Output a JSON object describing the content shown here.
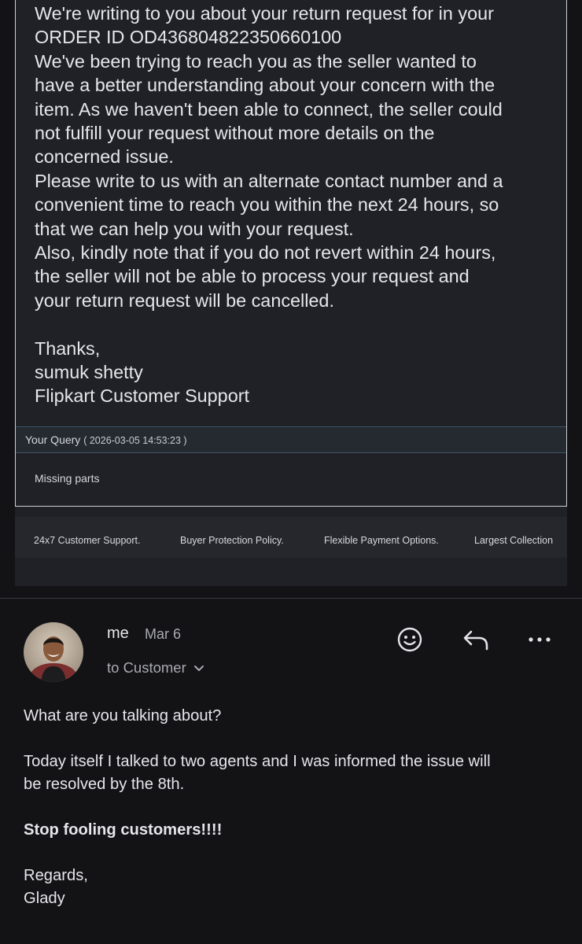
{
  "quoted_email": {
    "lines": [
      "We're writing to you about your return request for in your",
      "ORDER ID OD436804822350660100",
      "We've been trying to reach you as the seller wanted to",
      "have a better understanding about your concern with the",
      "item. As we haven't been able to connect, the seller could",
      "not fulfill your request without more details on the",
      "concerned issue.",
      "Please write to us with an alternate contact number and a",
      "convenient time to reach you within the next 24 hours, so",
      "that we can help you with your request.",
      "Also, kindly note that if you do not revert within 24 hours,",
      "the seller will not be able to process your request and",
      "your return request will be cancelled."
    ],
    "signoff": [
      "Thanks,",
      "sumuk shetty",
      "Flipkart Customer Support"
    ],
    "query_label": "Your Query",
    "query_timestamp": "( 2026-03-05 14:53:23 )",
    "query_text": "Missing parts",
    "features": [
      "24x7 Customer Support.",
      "Buyer Protection Policy.",
      "Flexible Payment Options.",
      "Largest Collection"
    ]
  },
  "reply": {
    "sender": "me",
    "date": "Mar 6",
    "recipient": "to Customer",
    "icons": [
      "avatar",
      "emoji-react-icon",
      "reply-icon",
      "more-options-icon",
      "chevron-down-icon"
    ],
    "body": {
      "p1": "What are you talking about?",
      "p2a": "Today itself I talked to two agents and I was informed the issue will",
      "p2b": "be resolved by the 8th.",
      "p3": "Stop fooling customers!!!!",
      "closing": "Regards,",
      "signature": "Glady"
    }
  }
}
